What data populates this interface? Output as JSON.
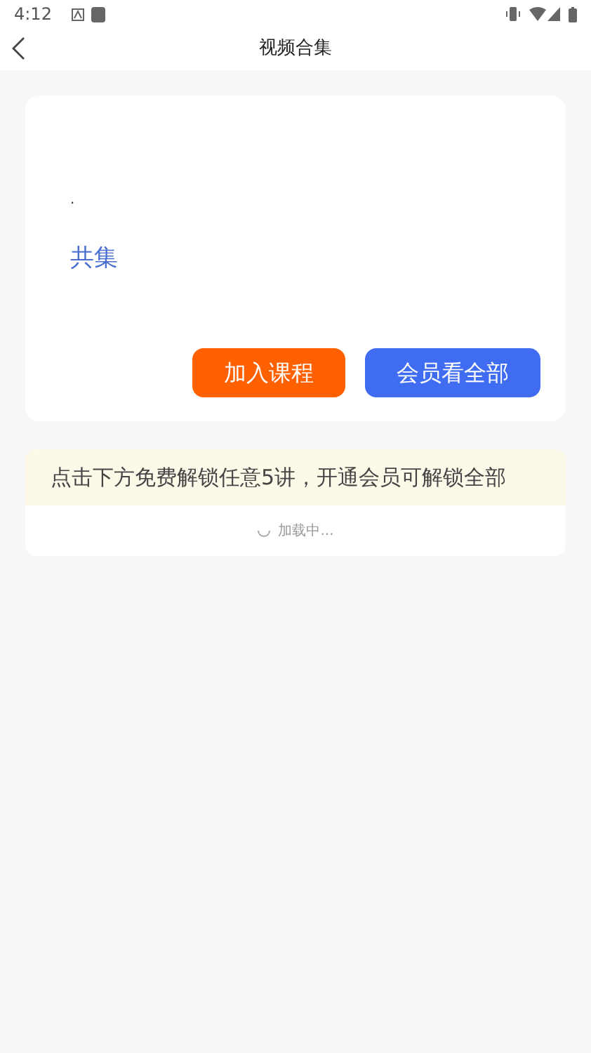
{
  "status_bar": {
    "time": "4:12"
  },
  "header": {
    "title": "视频合集"
  },
  "course": {
    "title": ".",
    "count_label": "共集",
    "buttons": [
      {
        "label": "加入课程",
        "kind": "join"
      },
      {
        "label": "会员看全部",
        "kind": "vip"
      }
    ]
  },
  "notice": {
    "text": "点击下方免费解锁任意5讲，开通会员可解锁全部"
  },
  "loading": {
    "text": "加载中..."
  }
}
